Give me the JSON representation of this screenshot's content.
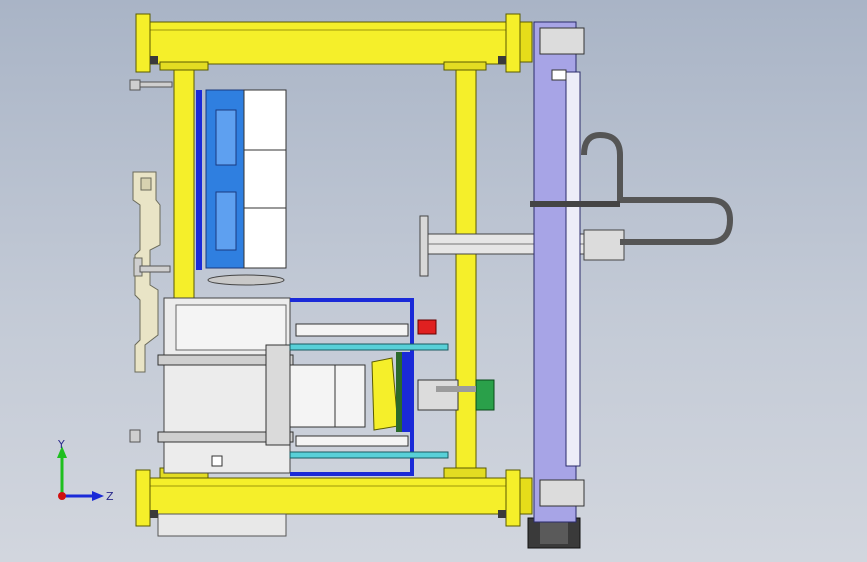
{
  "viewport": {
    "background_top": "#a9b4c6",
    "background_bottom": "#d2d6de"
  },
  "colors": {
    "frame_yellow": "#f5ef2a",
    "frame_edge": "#5a5a00",
    "plate_blue": "#2f7fe0",
    "rail_blue": "#1a2ad8",
    "cyan_rod": "#58d0d8",
    "lavender_panel": "#a7a4e6",
    "grey_part": "#9c9c9c",
    "dark_part": "#3a3a3a",
    "red_part": "#e02020",
    "green_part": "#2aa04a"
  },
  "triad": {
    "y_label": "Y",
    "z_label": "Z",
    "y_color": "#1fbf1f",
    "z_color": "#1a2ad8",
    "origin_color": "#d01010"
  }
}
